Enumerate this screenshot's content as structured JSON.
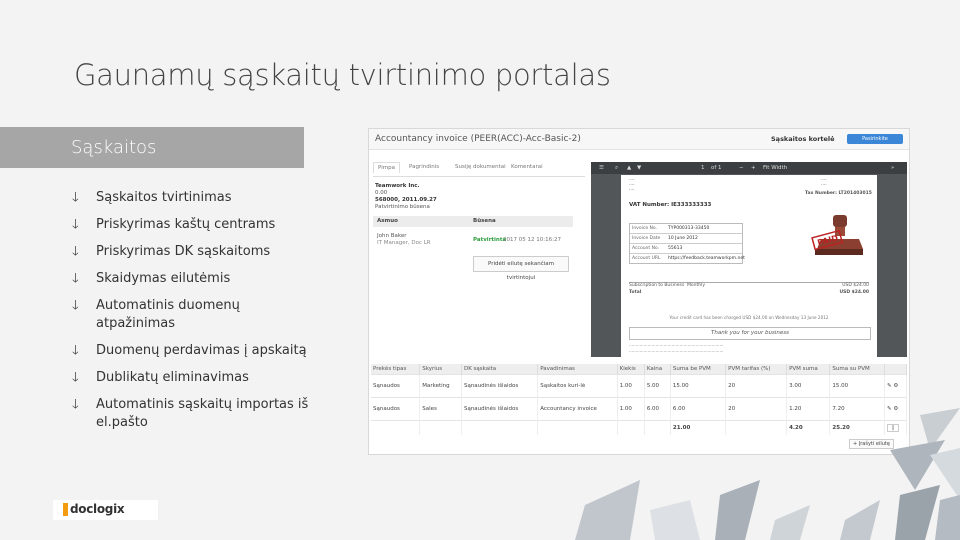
{
  "slide": {
    "title": "Gaunamų sąskaitų tvirtinimo portalas",
    "section": "Sąskaitos",
    "bullets": [
      "Sąskaitos tvirtinimas",
      "Priskyrimas kaštų centrams",
      "Priskyrimas DK sąskaitoms",
      "Skaidymas eilutėmis",
      "Automatinis duomenų atpažinimas",
      "Duomenų perdavimas į apskaitą",
      "Dublikatų eliminavimas",
      "Automatinis sąskaitų importas iš el.pašto"
    ],
    "logo": "doclogix"
  },
  "screenshot": {
    "doc_title": "Accountancy invoice (PEER(ACC)-Acc-Basic-2)",
    "portal_label": "Sąskaitos kortelė",
    "portal_select": "Pasirinkite",
    "tabs": [
      "Pimpa",
      "Pagrindinis",
      "Susiję dokumentai",
      "Komentarai"
    ],
    "company": "Teamwork Inc.",
    "info_lines": [
      "0.00",
      "568000, 2011.09.27"
    ],
    "approvers_label": "Patvirtinimo būsena",
    "col_approver": "Asmuo",
    "col_status": "Būsena",
    "approver_name": "John Baker",
    "approver_role": "IT Manager, Doc LR",
    "approve_status": "Patvirtinta",
    "approve_date": "2017 05 12 10:16:27",
    "add_approval": "Pridėti eilutę sekančiam tvirtintojui",
    "viewer": {
      "page": "1",
      "of": "of 1",
      "zoom": "Fit Width"
    },
    "vat_number": "VAT Number: IE333333333",
    "tax_number": "Tax Number: LT201403015",
    "kv": [
      {
        "k": "Invoice No.",
        "v": "TYP000313-33450"
      },
      {
        "k": "Invoice Date",
        "v": "10 June 2012"
      },
      {
        "k": "Account No.",
        "v": "55613"
      },
      {
        "k": "Account URL",
        "v": "https://feedback.teamworkpm.net"
      }
    ],
    "item_desc": "Subscription to Business",
    "item_plan": "Monthly",
    "item_price": "USD $24.00",
    "item_total_label": "Total",
    "item_total": "USD $24.00",
    "credit_line": "Your credit card has been charged USD $24.00 on Wednesday 13 June 2012",
    "thanks": "Thank you for your business",
    "grid_headers": [
      "Prekės tipas",
      "Skyrius",
      "DK sąskaita",
      "Pavadinimas",
      "Kiekis",
      "Kaina",
      "Suma be PVM",
      "PVM tarifas (%)",
      "PVM suma",
      "Suma su PVM"
    ],
    "grid_rows": [
      [
        "Sąnaudos",
        "Marketing",
        "Sąnaudinės išlaidos",
        "Sąskaitos kuri-lė",
        "1.00",
        "5.00",
        "15.00",
        "20",
        "3.00",
        "15.00"
      ],
      [
        "Sąnaudos",
        "Sales",
        "Sąnaudinės išlaidos",
        "Accountancy invoice",
        "1.00",
        "6.00",
        "6.00",
        "20",
        "1.20",
        "7.20"
      ]
    ],
    "grid_total": [
      "21.00",
      "4.20",
      "25.20"
    ],
    "add_line": "+ Įrašyti eilutę"
  }
}
